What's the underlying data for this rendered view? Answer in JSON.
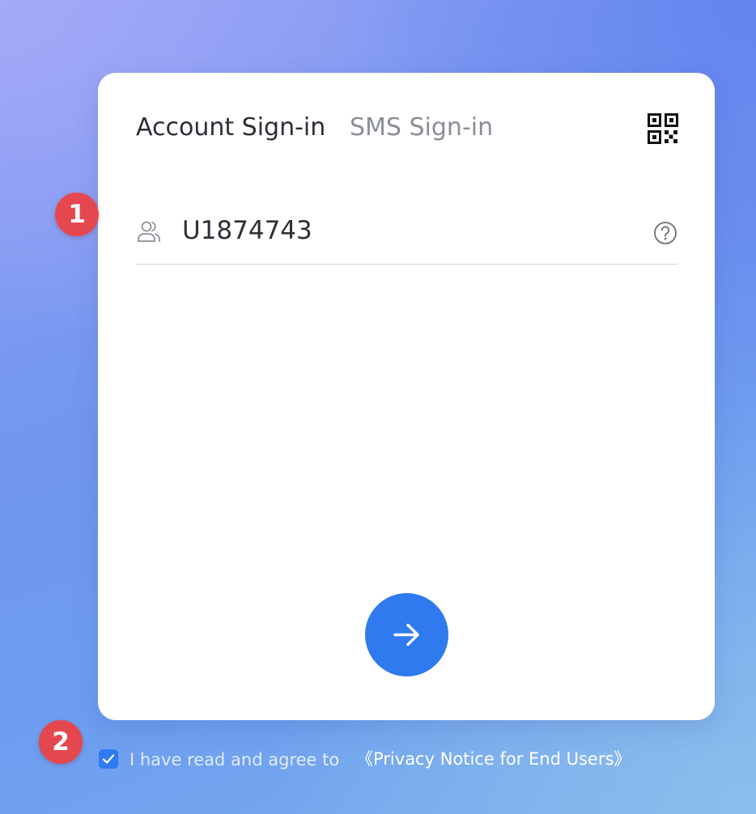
{
  "tabs": {
    "account": "Account Sign-in",
    "sms": "SMS Sign-in"
  },
  "username_field": {
    "value": "U1874743",
    "icon": "user-group-icon"
  },
  "icons": {
    "qr_code": "qr-code-icon",
    "help": "help-icon",
    "submit": "arrow-right-icon",
    "checkbox": "checkmark-icon"
  },
  "badges": {
    "step1": "1",
    "step2": "2"
  },
  "agreement": {
    "text": "I have read and agree to",
    "link": "《Privacy Notice for End Users》",
    "checked": true
  },
  "colors": {
    "accent": "#2f7aee",
    "badge": "#e5474f",
    "active_tab": "#2b2f36",
    "inactive_tab": "#8a8e96"
  }
}
